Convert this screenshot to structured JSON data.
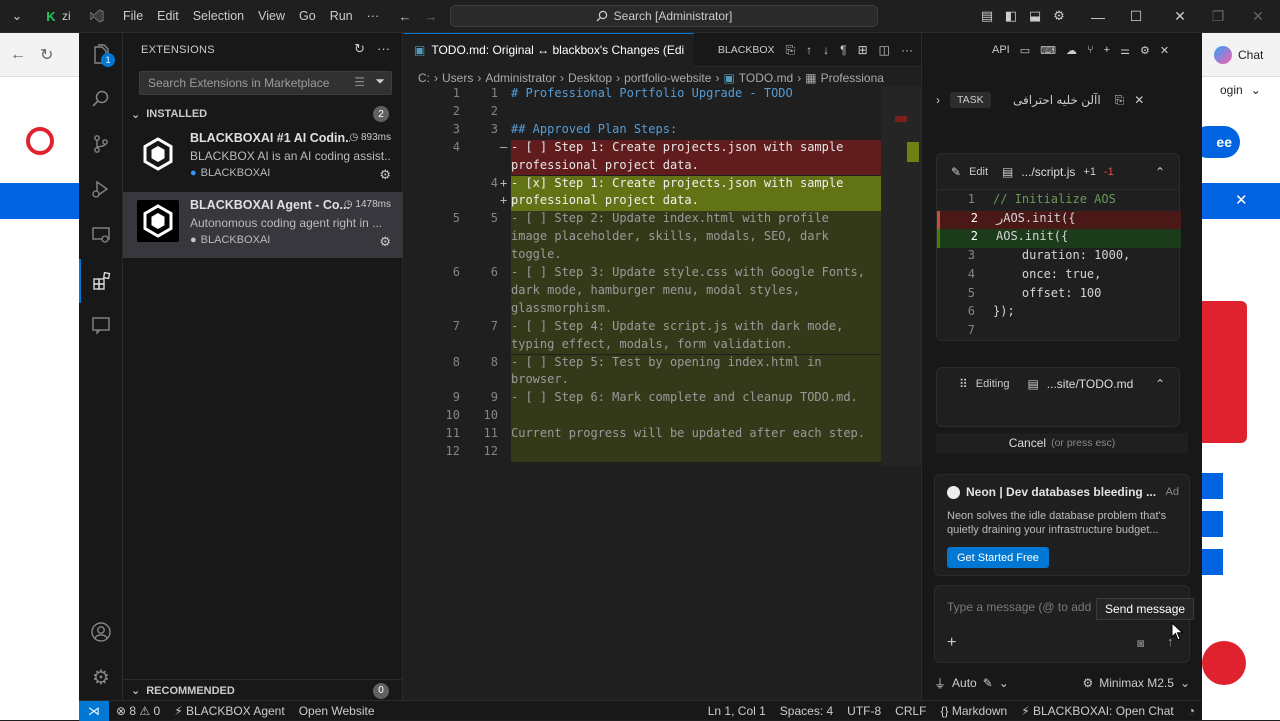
{
  "titlebar": {
    "menus": [
      "File",
      "Edit",
      "Selection",
      "View",
      "Go",
      "Run"
    ],
    "more": "···",
    "search": "Search [Administrator]",
    "browser_tab_text": "zi"
  },
  "browser": {
    "right_chat": "Chat",
    "right_login": "ogin",
    "right_button": "ee"
  },
  "sidebar": {
    "title": "EXTENSIONS",
    "search_placeholder": "Search Extensions in Marketplace",
    "installed_label": "INSTALLED",
    "installed_count": "2",
    "recommended_label": "RECOMMENDED",
    "recommended_count": "0",
    "extensions": [
      {
        "name": "BLACKBOXAI #1 AI Codin...",
        "time": "893ms",
        "description": "BLACKBOX AI is an AI coding assist...",
        "publisher": "BLACKBOXAI"
      },
      {
        "name": "BLACKBOXAI Agent - Co...",
        "time": "1478ms",
        "description": "Autonomous coding agent right in ...",
        "publisher": "BLACKBOXAI"
      }
    ]
  },
  "editor": {
    "tab_title": "TODO.md: Original ↔ blackbox's Changes (Edi",
    "tab_action_label": "BLACKBOX",
    "breadcrumb": [
      "C:",
      "Users",
      "Administrator",
      "Desktop",
      "portfolio-website",
      "TODO.md",
      "Professiona"
    ],
    "lines": [
      {
        "l": "1",
        "r": "1",
        "m": "",
        "text": "# Professional Portfolio Upgrade - TODO",
        "kind": "heading"
      },
      {
        "l": "2",
        "r": "2",
        "m": "",
        "text": "",
        "kind": "plain"
      },
      {
        "l": "3",
        "r": "3",
        "m": "",
        "text": "## Approved Plan Steps:",
        "kind": "heading"
      },
      {
        "l": "4",
        "r": "",
        "m": "—",
        "text": "- [ ] Step 1: Create projects.json with sample",
        "kind": "del"
      },
      {
        "l": "",
        "r": "",
        "m": "",
        "text": "professional project data.",
        "kind": "del"
      },
      {
        "l": "",
        "r": "4",
        "m": "+",
        "text": "- [x] Step 1: Create projects.json with sample",
        "kind": "add"
      },
      {
        "l": "",
        "r": "",
        "m": "+",
        "text": "professional project data.",
        "kind": "add"
      },
      {
        "l": "5",
        "r": "5",
        "m": "",
        "text": "- [ ] Step 2: Update index.html with profile",
        "kind": "mod"
      },
      {
        "l": "",
        "r": "",
        "m": "",
        "text": "image placeholder, skills, modals, SEO, dark",
        "kind": "mod"
      },
      {
        "l": "",
        "r": "",
        "m": "",
        "text": "toggle.",
        "kind": "mod"
      },
      {
        "l": "6",
        "r": "6",
        "m": "",
        "text": "- [ ] Step 3: Update style.css with Google Fonts,",
        "kind": "mod"
      },
      {
        "l": "",
        "r": "",
        "m": "",
        "text": "dark mode, hamburger menu, modal styles,",
        "kind": "mod"
      },
      {
        "l": "",
        "r": "",
        "m": "",
        "text": "glassmorphism.",
        "kind": "mod"
      },
      {
        "l": "7",
        "r": "7",
        "m": "",
        "text": "- [ ] Step 4: Update script.js with dark mode,",
        "kind": "mod"
      },
      {
        "l": "",
        "r": "",
        "m": "",
        "text": "typing effect, modals, form validation.",
        "kind": "mod"
      },
      {
        "l": "8",
        "r": "8",
        "m": "",
        "text": "- [ ] Step 5: Test by opening index.html in",
        "kind": "mod"
      },
      {
        "l": "",
        "r": "",
        "m": "",
        "text": "browser.",
        "kind": "mod"
      },
      {
        "l": "9",
        "r": "9",
        "m": "",
        "text": "- [ ] Step 6: Mark complete and cleanup TODO.md.",
        "kind": "mod"
      },
      {
        "l": "10",
        "r": "10",
        "m": "",
        "text": "",
        "kind": "mod"
      },
      {
        "l": "11",
        "r": "11",
        "m": "",
        "text": "Current progress will be updated after each step.",
        "kind": "mod"
      },
      {
        "l": "12",
        "r": "12",
        "m": "",
        "text": "",
        "kind": "mod"
      }
    ]
  },
  "chat": {
    "top_api": "API",
    "task_label": "TASK",
    "task_text": "اآلن خليه احترافى",
    "edit_label": "Edit",
    "edit_file": ".../script.js",
    "edit_plus": "+1",
    "edit_minus": "-1",
    "code_lines": [
      {
        "n": "1",
        "text": "// Initialize AOS",
        "kind": "comment"
      },
      {
        "n": "2",
        "text": "رAOS.init({",
        "kind": "del"
      },
      {
        "n": "2",
        "text": "AOS.init({",
        "kind": "add"
      },
      {
        "n": "3",
        "text": "    duration: 1000,",
        "kind": "plain"
      },
      {
        "n": "4",
        "text": "    once: true,",
        "kind": "plain"
      },
      {
        "n": "5",
        "text": "    offset: 100",
        "kind": "plain"
      },
      {
        "n": "6",
        "text": "});",
        "kind": "plain"
      },
      {
        "n": "7",
        "text": "",
        "kind": "plain"
      }
    ],
    "editing_label": "Editing",
    "editing_file": "...site/TODO.md",
    "cancel_label": "Cancel",
    "cancel_hint": "(or press esc)",
    "ad": {
      "title": "Neon | Dev databases bleeding ...",
      "tag": "Ad",
      "body": "Neon solves the idle database problem that's quietly draining your infrastructure budget...",
      "cta": "Get Started Free"
    },
    "input_placeholder": "Type a message (@ to add",
    "send_tooltip": "Send message",
    "mode": "Auto",
    "model": "Minimax M2.5"
  },
  "statusbar": {
    "errors": "8",
    "warnings": "0",
    "agent": "BLACKBOX Agent",
    "open_website": "Open Website",
    "position": "Ln 1, Col 1",
    "spaces": "Spaces: 4",
    "encoding": "UTF-8",
    "eol": "CRLF",
    "language": "Markdown",
    "open_chat": "BLACKBOXAI: Open Chat"
  },
  "colors": {
    "accent": "#0078d4",
    "deleted_line": "#7a1e1e",
    "added_line": "#6e8214",
    "ad_button": "#0078d4"
  }
}
